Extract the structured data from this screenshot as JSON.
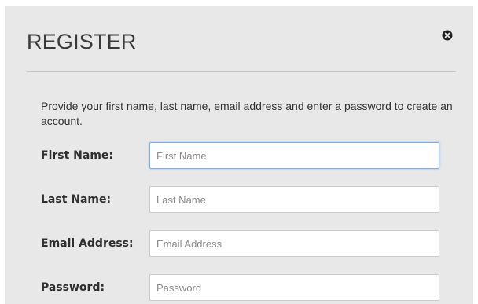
{
  "modal": {
    "title": "REGISTER",
    "close_icon": "close-circle-icon",
    "intro": "Provide your first name, last name, email address and enter a password to create an account."
  },
  "form": {
    "fields": [
      {
        "label": "First Name:",
        "placeholder": "First Name",
        "value": "",
        "focused": true
      },
      {
        "label": "Last Name:",
        "placeholder": "Last Name",
        "value": ""
      },
      {
        "label": "Email Address:",
        "placeholder": "Email Address",
        "value": ""
      },
      {
        "label": "Password:",
        "placeholder": "Password",
        "value": ""
      }
    ]
  },
  "colors": {
    "modal_background": "#e8e8e8",
    "focus_border": "#7fb1dd",
    "text": "#333333"
  }
}
